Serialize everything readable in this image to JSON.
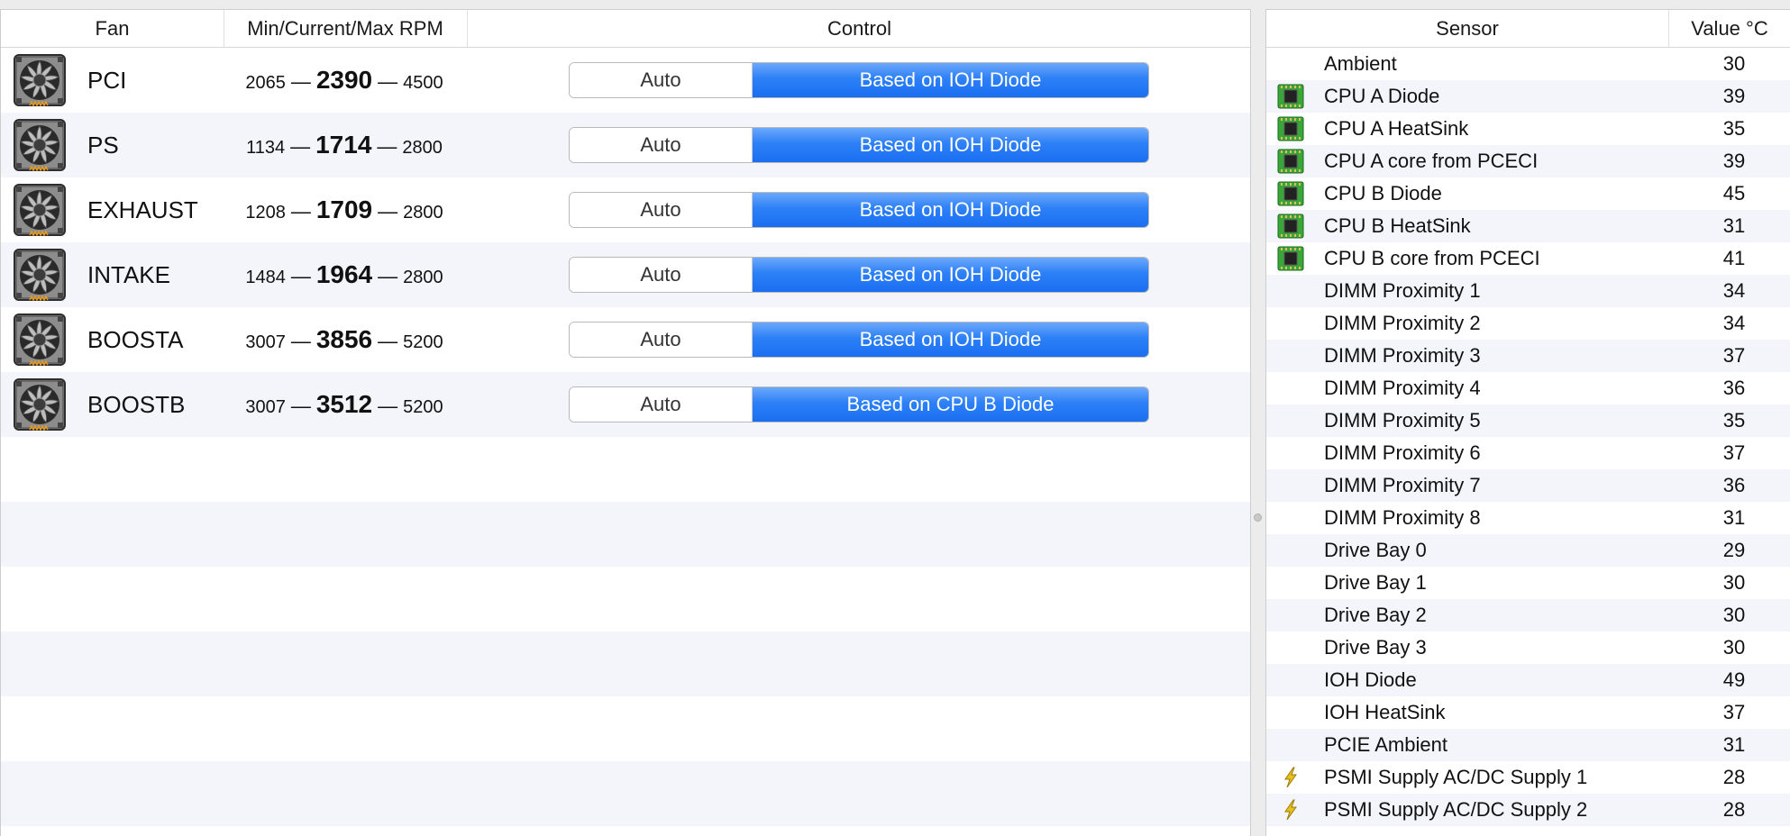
{
  "fans_table": {
    "columns": {
      "fan": "Fan",
      "rpm": "Min/Current/Max RPM",
      "control": "Control"
    },
    "rows": [
      {
        "name": "PCI",
        "min": "2065",
        "current": "2390",
        "max": "4500",
        "control_auto": "Auto",
        "control_selected": "Based on IOH Diode"
      },
      {
        "name": "PS",
        "min": "1134",
        "current": "1714",
        "max": "2800",
        "control_auto": "Auto",
        "control_selected": "Based on IOH Diode"
      },
      {
        "name": "EXHAUST",
        "min": "1208",
        "current": "1709",
        "max": "2800",
        "control_auto": "Auto",
        "control_selected": "Based on IOH Diode"
      },
      {
        "name": "INTAKE",
        "min": "1484",
        "current": "1964",
        "max": "2800",
        "control_auto": "Auto",
        "control_selected": "Based on IOH Diode"
      },
      {
        "name": "BOOSTA",
        "min": "3007",
        "current": "3856",
        "max": "5200",
        "control_auto": "Auto",
        "control_selected": "Based on IOH Diode"
      },
      {
        "name": "BOOSTB",
        "min": "3007",
        "current": "3512",
        "max": "5200",
        "control_auto": "Auto",
        "control_selected": "Based on CPU B Diode"
      }
    ],
    "dash": "—",
    "icon": "fan-icon"
  },
  "sensors_table": {
    "columns": {
      "sensor": "Sensor",
      "value": "Value °C"
    },
    "rows": [
      {
        "name": "Ambient",
        "value": "30",
        "icon": "none"
      },
      {
        "name": "CPU A Diode",
        "value": "39",
        "icon": "cpu-chip-icon"
      },
      {
        "name": "CPU A HeatSink",
        "value": "35",
        "icon": "cpu-chip-icon"
      },
      {
        "name": "CPU A core from PCECI",
        "value": "39",
        "icon": "cpu-chip-icon"
      },
      {
        "name": "CPU B Diode",
        "value": "45",
        "icon": "cpu-chip-icon"
      },
      {
        "name": "CPU B HeatSink",
        "value": "31",
        "icon": "cpu-chip-icon"
      },
      {
        "name": "CPU B core from PCECI",
        "value": "41",
        "icon": "cpu-chip-icon"
      },
      {
        "name": "DIMM Proximity 1",
        "value": "34",
        "icon": "none"
      },
      {
        "name": "DIMM Proximity 2",
        "value": "34",
        "icon": "none"
      },
      {
        "name": "DIMM Proximity 3",
        "value": "37",
        "icon": "none"
      },
      {
        "name": "DIMM Proximity 4",
        "value": "36",
        "icon": "none"
      },
      {
        "name": "DIMM Proximity 5",
        "value": "35",
        "icon": "none"
      },
      {
        "name": "DIMM Proximity 6",
        "value": "37",
        "icon": "none"
      },
      {
        "name": "DIMM Proximity 7",
        "value": "36",
        "icon": "none"
      },
      {
        "name": "DIMM Proximity 8",
        "value": "31",
        "icon": "none"
      },
      {
        "name": "Drive Bay 0",
        "value": "29",
        "icon": "none"
      },
      {
        "name": "Drive Bay 1",
        "value": "30",
        "icon": "none"
      },
      {
        "name": "Drive Bay 2",
        "value": "30",
        "icon": "none"
      },
      {
        "name": "Drive Bay 3",
        "value": "30",
        "icon": "none"
      },
      {
        "name": "IOH Diode",
        "value": "49",
        "icon": "none"
      },
      {
        "name": "IOH HeatSink",
        "value": "37",
        "icon": "none"
      },
      {
        "name": "PCIE Ambient",
        "value": "31",
        "icon": "none"
      },
      {
        "name": "PSMI Supply AC/DC Supply 1",
        "value": "28",
        "icon": "lightning-bolt-icon"
      },
      {
        "name": "PSMI Supply AC/DC Supply 2",
        "value": "28",
        "icon": "lightning-bolt-icon"
      }
    ]
  },
  "colors": {
    "selected_segment": "#2d80f6",
    "row_stripe": "#f3f5fb",
    "chip_green": "#3aa63a",
    "bolt_yellow": "#e8c020"
  }
}
